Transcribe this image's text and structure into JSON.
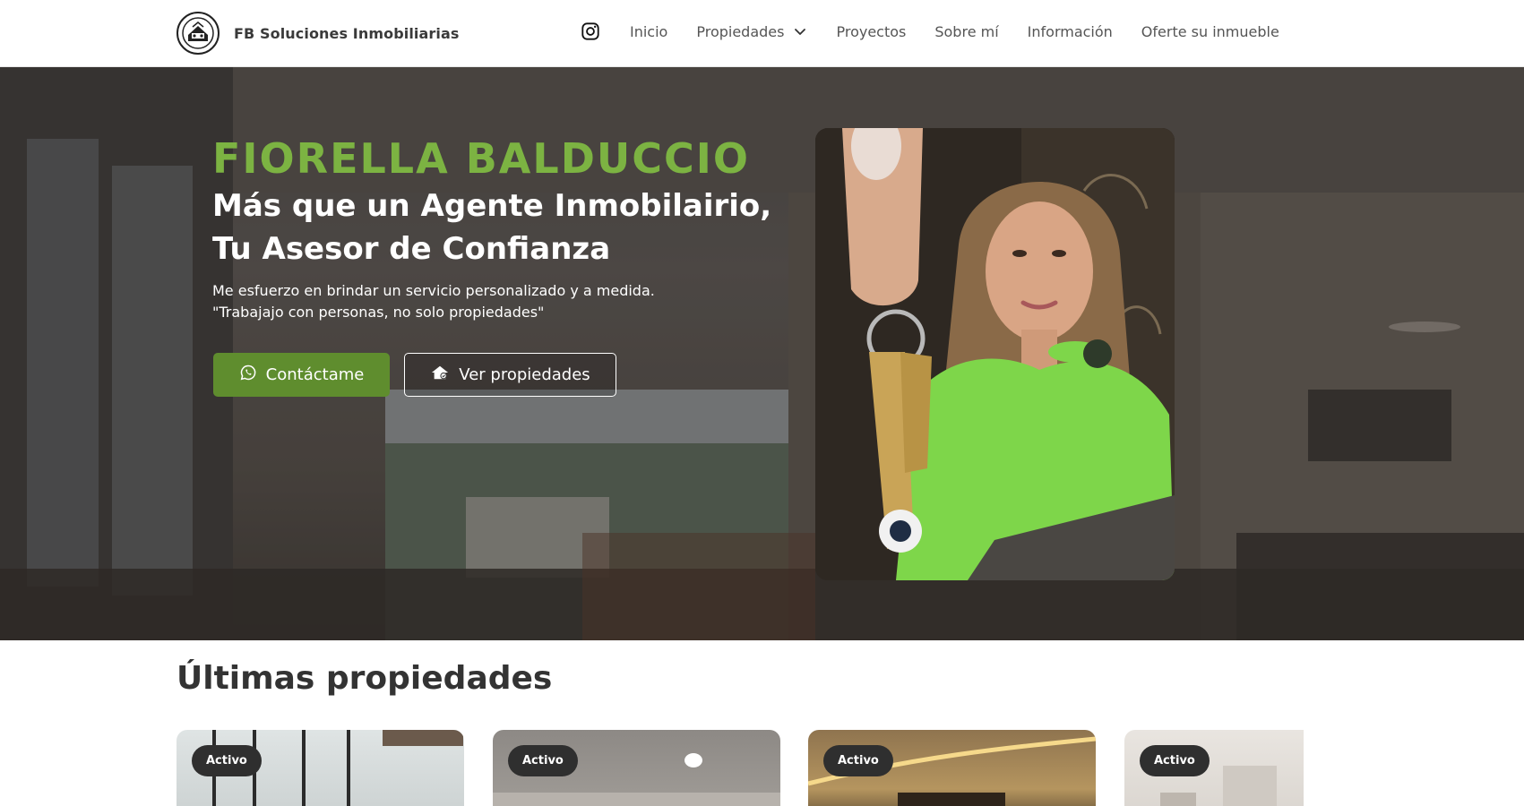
{
  "brand": {
    "name": "FB Soluciones Inmobiliarias",
    "logo_icon": "house-seal-logo-icon"
  },
  "nav": {
    "instagram_icon": "instagram-icon",
    "items": [
      {
        "label": "Inicio"
      },
      {
        "label": "Propiedades",
        "has_dropdown": true
      },
      {
        "label": "Proyectos"
      },
      {
        "label": "Sobre mí"
      },
      {
        "label": "Información"
      },
      {
        "label": "Oferte su inmueble"
      }
    ]
  },
  "hero": {
    "name": "FIORELLA BALDUCCIO",
    "tagline_line1": "Más que un Agente Inmobilairio,",
    "tagline_line2": "Tu Asesor de Confianza",
    "description_line1": "Me esfuerzo en brindar un servicio personalizado y a medida.",
    "description_line2": "\"Trabajajo con personas, no solo propiedades\"",
    "primary_button": {
      "label": "Contáctame",
      "icon": "whatsapp-icon"
    },
    "secondary_button": {
      "label": "Ver propiedades",
      "icon": "house-icon"
    }
  },
  "latest": {
    "title": "Últimas propiedades",
    "cards": [
      {
        "status": "Activo"
      },
      {
        "status": "Activo"
      },
      {
        "status": "Activo"
      },
      {
        "status": "Activo"
      }
    ]
  },
  "colors": {
    "accent_green": "#7cb342",
    "button_green": "#5f8d2e",
    "badge_dark": "#2f2f2f"
  }
}
